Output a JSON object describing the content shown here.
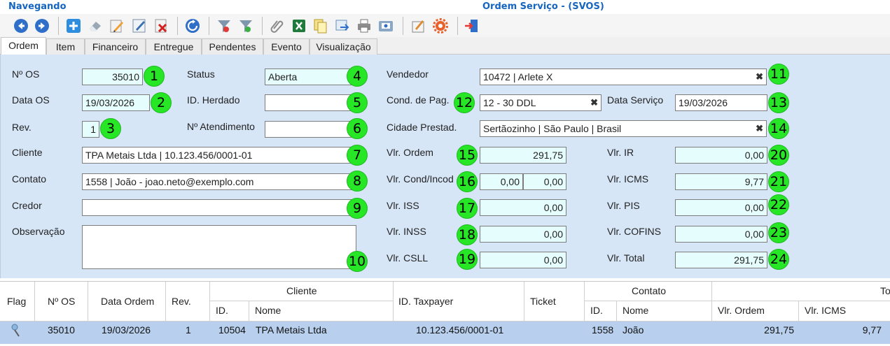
{
  "window": {
    "mode": "Navegando",
    "title": "Ordem Serviço - (SVOS)"
  },
  "toolbar": [
    {
      "icon": "back-arrow-icon"
    },
    {
      "icon": "forward-arrow-icon"
    },
    {
      "icon": "add-icon"
    },
    {
      "icon": "eraser-icon"
    },
    {
      "icon": "edit-pencil-icon"
    },
    {
      "icon": "edit-form-icon"
    },
    {
      "icon": "delete-icon"
    },
    {
      "icon": "refresh-icon"
    },
    {
      "icon": "filter-icon"
    },
    {
      "icon": "filter-apply-icon"
    },
    {
      "icon": "attach-clip-icon"
    },
    {
      "icon": "excel-icon"
    },
    {
      "icon": "copy-icon"
    },
    {
      "icon": "transfer-icon"
    },
    {
      "icon": "print-icon"
    },
    {
      "icon": "email-icon"
    },
    {
      "icon": "report-icon"
    },
    {
      "icon": "settings-gear-icon"
    },
    {
      "icon": "exit-door-icon"
    }
  ],
  "tabs": [
    "Ordem",
    "Item",
    "Financeiro",
    "Entregue",
    "Pendentes",
    "Evento",
    "Visualização"
  ],
  "form": {
    "labels": {
      "num_os": "Nº OS",
      "data_os": "Data OS",
      "rev": "Rev.",
      "cliente": "Cliente",
      "contato": "Contato",
      "credor": "Credor",
      "observacao": "Observação",
      "status": "Status",
      "id_herdado": "ID. Herdado",
      "num_atendimento": "Nº Atendimento",
      "vendedor": "Vendedor",
      "cond_pag": "Cond. de Pag.",
      "data_servico": "Data Serviço",
      "cidade_prestad": "Cidade Prestad.",
      "vlr_ordem": "Vlr. Ordem",
      "vlr_cond_incod": "Vlr. Cond/Incod",
      "vlr_iss": "Vlr. ISS",
      "vlr_inss": "Vlr. INSS",
      "vlr_csll": "Vlr. CSLL",
      "vlr_ir": "Vlr. IR",
      "vlr_icms": "Vlr. ICMS",
      "vlr_pis": "Vlr. PIS",
      "vlr_cofins": "Vlr. COFINS",
      "vlr_total": "Vlr. Total"
    },
    "values": {
      "num_os": "35010",
      "data_os": "19/03/2026",
      "rev": "1",
      "cliente": "TPA Metais Ltda | 10.123.456/0001-01",
      "contato": "1558 | João - joao.neto@exemplo.com",
      "credor": "",
      "observacao": "",
      "status": "Aberta",
      "id_herdado": "",
      "num_atendimento": "",
      "vendedor": "10472 | Arlete X",
      "cond_pag": "12 - 30 DDL",
      "data_servico": "19/03/2026",
      "cidade_prestad": "Sertãozinho | São Paulo | Brasil",
      "vlr_ordem": "291,75",
      "vlr_cond": "0,00",
      "vlr_incod": "0,00",
      "vlr_iss": "0,00",
      "vlr_inss": "0,00",
      "vlr_csll": "0,00",
      "vlr_ir": "0,00",
      "vlr_icms": "9,77",
      "vlr_pis": "0,00",
      "vlr_cofins": "0,00",
      "vlr_total": "291,75"
    },
    "clear_glyph": "✖",
    "badges": [
      "1",
      "2",
      "3",
      "4",
      "5",
      "6",
      "7",
      "8",
      "9",
      "10",
      "11",
      "12",
      "13",
      "14",
      "15",
      "16",
      "17",
      "18",
      "19",
      "20",
      "21",
      "22",
      "23",
      "24"
    ]
  },
  "grid": {
    "headers": {
      "flag": "Flag",
      "num_os": "Nº OS",
      "data_ordem": "Data Ordem",
      "rev": "Rev.",
      "cliente": "Cliente",
      "cliente_id": "ID.",
      "cliente_nome": "Nome",
      "id_taxpayer": "ID. Taxpayer",
      "ticket": "Ticket",
      "contato": "Contato",
      "contato_id": "ID.",
      "contato_nome": "Nome",
      "totais": "To",
      "vlr_ordem": "Vlr. Ordem",
      "vlr_icms": "Vlr. ICMS"
    },
    "rows": [
      {
        "flag_icon": "pin-icon",
        "num_os": "35010",
        "data_ordem": "19/03/2026",
        "rev": "1",
        "cliente_id": "10504",
        "cliente_nome": "TPA Metais Ltda",
        "id_taxpayer": "10.123.456/0001-01",
        "ticket": "",
        "contato_id": "1558",
        "contato_nome": "João",
        "vlr_ordem": "291,75",
        "vlr_icms": "9,77"
      }
    ]
  }
}
